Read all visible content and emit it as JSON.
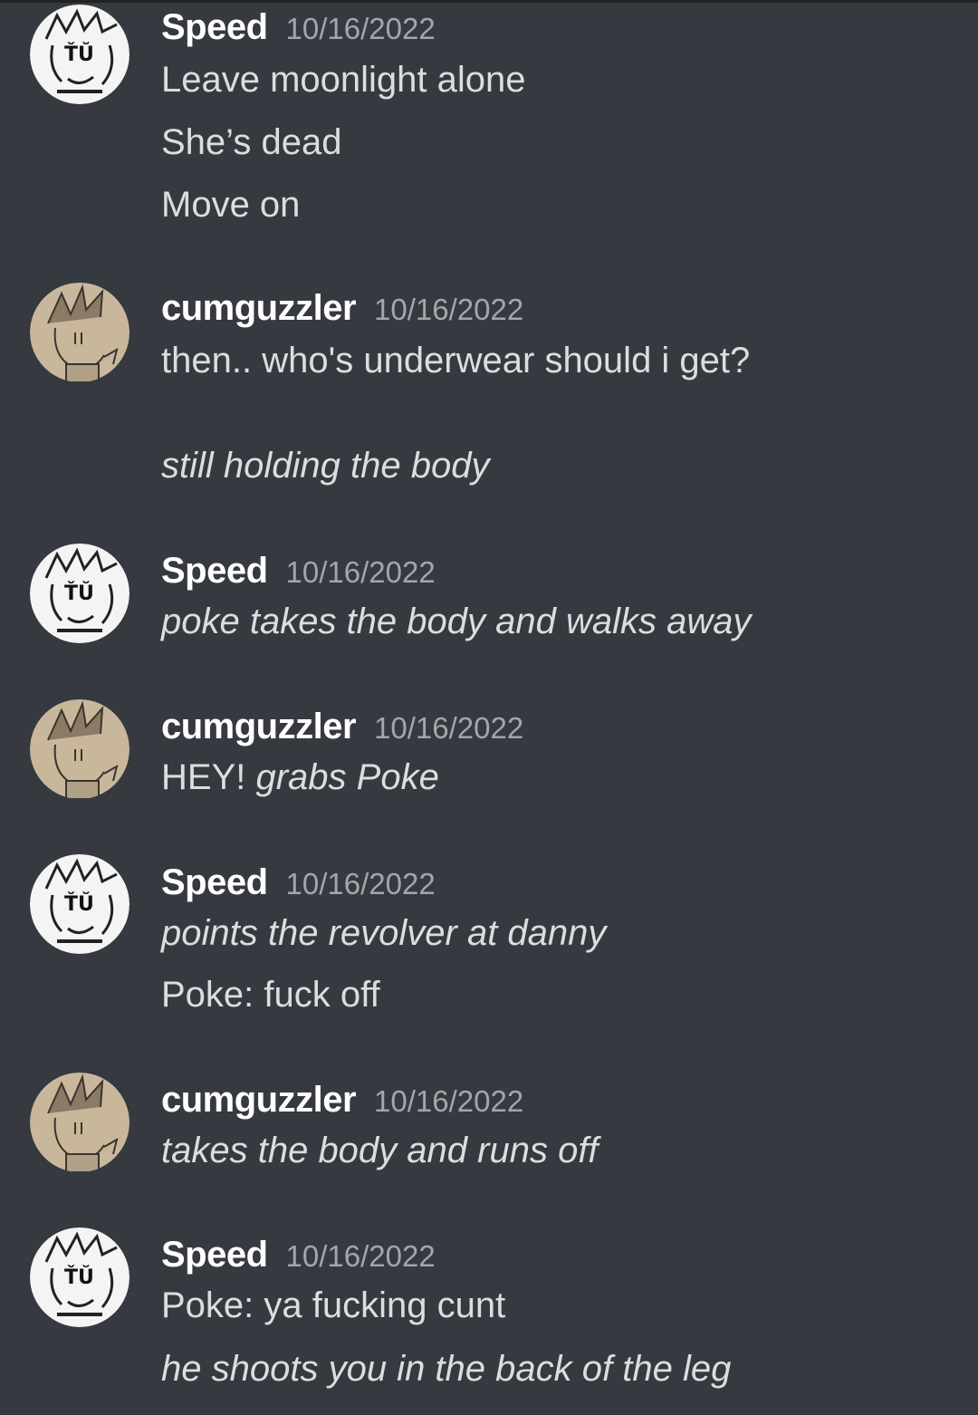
{
  "colors": {
    "background": "#36393f",
    "username": "#ffffff",
    "timestamp": "#a3a6aa",
    "message_text": "#dcddde"
  },
  "messages": [
    {
      "author": "Speed",
      "avatar": "speed-avatar",
      "timestamp": "10/16/2022",
      "lines": [
        {
          "text": "Leave moonlight alone"
        },
        {
          "text": "She’s dead"
        },
        {
          "text": "Move on"
        }
      ]
    },
    {
      "author": "cumguzzler",
      "avatar": "cumguzzler-avatar",
      "timestamp": "10/16/2022",
      "lines": [
        {
          "text": "then.. who's underwear should i get?"
        },
        {
          "text": "still holding the body",
          "italic": true
        }
      ]
    },
    {
      "author": "Speed",
      "avatar": "speed-avatar",
      "timestamp": "10/16/2022",
      "lines": [
        {
          "text": "poke takes the body and walks away",
          "italic": true
        }
      ]
    },
    {
      "author": "cumguzzler",
      "avatar": "cumguzzler-avatar",
      "timestamp": "10/16/2022",
      "lines": [
        {
          "prefix": "HEY! ",
          "text": "grabs Poke",
          "italic": true
        }
      ]
    },
    {
      "author": "Speed",
      "avatar": "speed-avatar",
      "timestamp": "10/16/2022",
      "lines": [
        {
          "text": "points the revolver at danny",
          "italic": true
        },
        {
          "text": "Poke: fuck off"
        }
      ]
    },
    {
      "author": "cumguzzler",
      "avatar": "cumguzzler-avatar",
      "timestamp": "10/16/2022",
      "lines": [
        {
          "text": "takes the body and runs off",
          "italic": true
        }
      ]
    },
    {
      "author": "Speed",
      "avatar": "speed-avatar",
      "timestamp": "10/16/2022",
      "lines": [
        {
          "text": "Poke: ya fucking cunt"
        },
        {
          "text": "he shoots you in the back of the leg",
          "italic": true
        }
      ]
    }
  ]
}
